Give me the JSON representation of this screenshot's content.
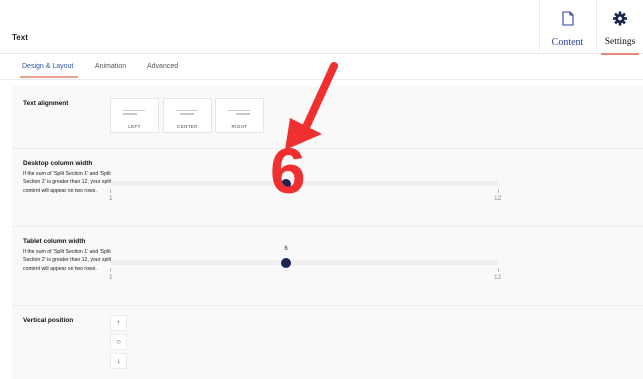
{
  "header": {
    "title": "Text",
    "tabs": [
      {
        "label": "Content",
        "icon": "document-icon"
      },
      {
        "label": "Settings",
        "icon": "gear-icon"
      }
    ]
  },
  "subtabs": {
    "items": [
      "Design & Layout",
      "Animation",
      "Advanced"
    ],
    "active": "Design & Layout"
  },
  "text_alignment": {
    "title": "Text alignment",
    "options": [
      "LEFT",
      "CENTER",
      "RIGHT"
    ]
  },
  "desktop_width": {
    "title": "Desktop column width",
    "description": "If the sum of 'Split Section 1' and 'Split Section 2' is greater than 12, your split content will appear on two rows.",
    "min_label": "1",
    "max_label": "12",
    "min": 1,
    "max": 12,
    "value": 6
  },
  "tablet_width": {
    "title": "Tablet column width",
    "description": "If the sum of 'Split Section 1' and 'Split Section 2' is greater than 12, your split content will appear on two rows.",
    "min_label": "1",
    "max_label": "12",
    "min": 1,
    "max": 12,
    "value": 6,
    "value_label": "6"
  },
  "vertical_position": {
    "title": "Vertical position",
    "options": [
      "arrow-up-icon",
      "center-icon",
      "arrow-down-icon"
    ]
  },
  "annotation": {
    "number": "6",
    "color": "#f03030"
  },
  "colors": {
    "accent_blue": "#2a56a8",
    "thumb": "#1b2550",
    "underline": "#e9a38f"
  }
}
